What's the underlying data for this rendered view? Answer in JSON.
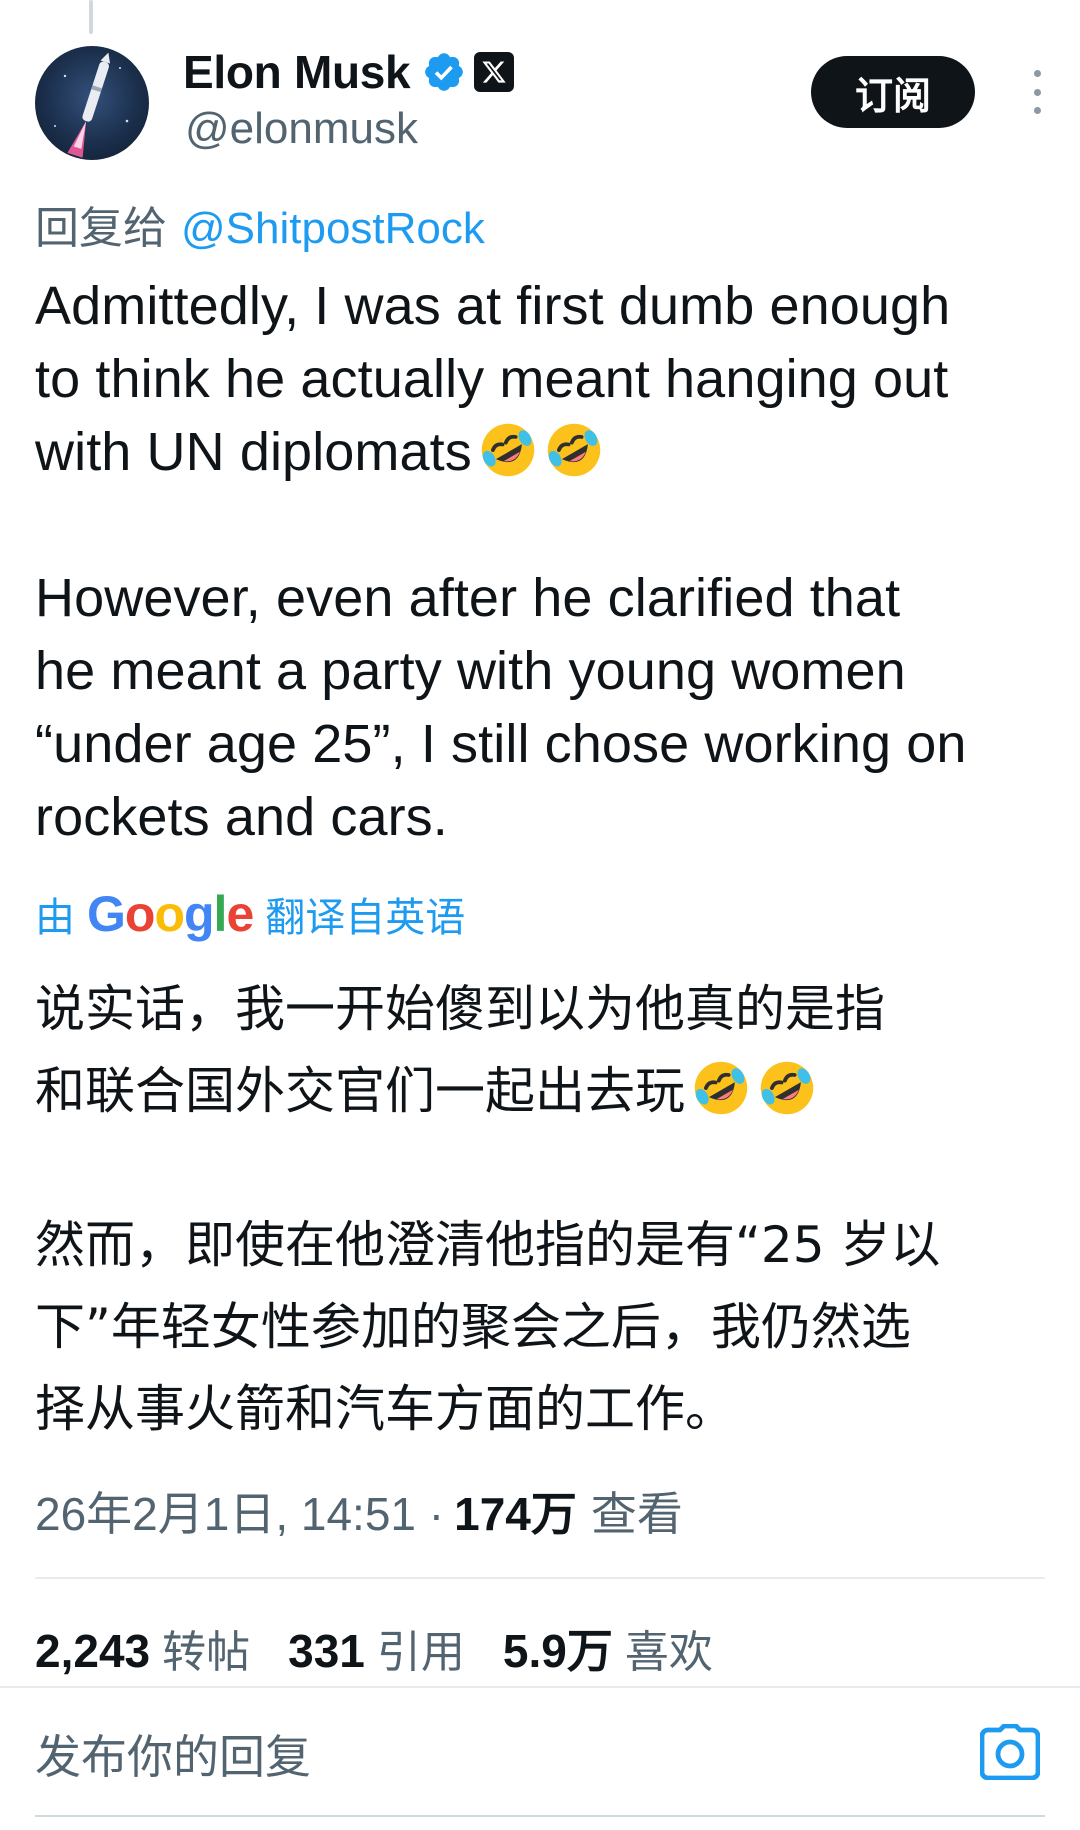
{
  "author": {
    "name": "Elon Musk",
    "handle": "@elonmusk"
  },
  "actions": {
    "subscribe_label": "订阅"
  },
  "reply_to": {
    "prefix": "回复给",
    "mention": "@ShitpostRock"
  },
  "tweet": {
    "paragraph_1": "Admittedly, I was at first dumb enough\nto think he actually meant hanging out\nwith UN diplomats",
    "paragraph_2": "However, even after he clarified that\nhe meant a party with young women\n“under age 25”, I still chose working on\nrockets and cars."
  },
  "translation": {
    "prefix": "由",
    "brand": "Google",
    "suffix": "翻译自英语",
    "paragraph_1_line_1": "说实话，我一开始傻到以为他真的是指",
    "paragraph_1_line_2": "和联合国外交官们一起出去玩",
    "paragraph_2_line_1": "然而，即使在他澄清他指的是有“25 岁以",
    "paragraph_2_line_2": "下”年轻女性参加的聚会之后，我仍然选",
    "paragraph_2_line_3": "择从事火箭和汽车方面的工作。"
  },
  "meta": {
    "timestamp": "26年2月1日, 14:51 ·",
    "views_count": "174万",
    "views_label": "查看"
  },
  "stats": {
    "reposts_count": "2,243",
    "reposts_label": "转帖",
    "quotes_count": "331",
    "quotes_label": "引用",
    "likes_count": "5.9万",
    "likes_label": "喜欢"
  },
  "reply_box": {
    "placeholder": "发布你的回复"
  },
  "icons": {
    "emoji": "rolling-on-floor-laughing",
    "verified": "verified-badge",
    "x_affiliation": "x-logo",
    "more": "more-vertical",
    "camera": "camera"
  },
  "colors": {
    "link": "#1d9bf0",
    "text": "#0f1419",
    "secondary": "#536471"
  }
}
